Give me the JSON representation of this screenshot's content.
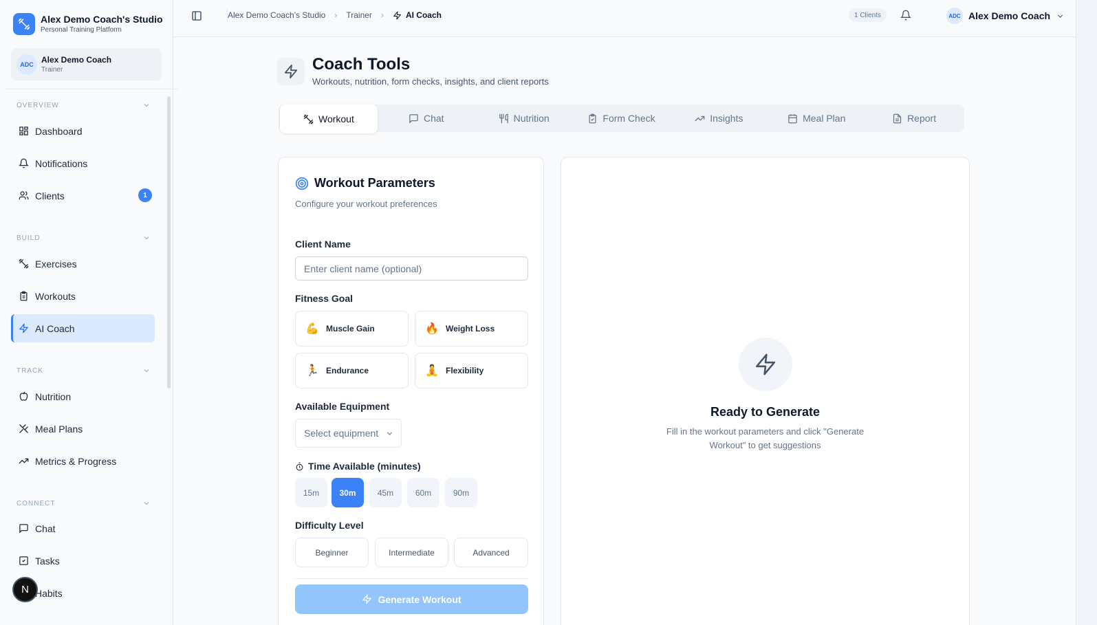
{
  "brand": {
    "name": "Alex Demo Coach's Studio",
    "subtitle": "Personal Training Platform"
  },
  "user": {
    "initials": "ADC",
    "name": "Alex Demo Coach",
    "role": "Trainer"
  },
  "sidebar": {
    "sections": {
      "overview": "OVERVIEW",
      "build": "BUILD",
      "track": "TRACK",
      "connect": "CONNECT"
    },
    "items": {
      "dashboard": "Dashboard",
      "notifications": "Notifications",
      "clients": "Clients",
      "clients_badge": "1",
      "exercises": "Exercises",
      "workouts": "Workouts",
      "ai_coach": "AI Coach",
      "nutrition": "Nutrition",
      "meal_plans": "Meal Plans",
      "metrics": "Metrics & Progress",
      "chat": "Chat",
      "tasks": "Tasks",
      "habits": "Habits"
    },
    "fab_letter": "N"
  },
  "topbar": {
    "breadcrumb": [
      "Alex Demo Coach's Studio",
      "Trainer",
      "AI Coach"
    ],
    "clients_count": "1 Clients",
    "user_initials": "ADC",
    "user_name": "Alex Demo Coach"
  },
  "page": {
    "title": "Coach Tools",
    "subtitle": "Workouts, nutrition, form checks, insights, and client reports",
    "tabs": [
      "Workout",
      "Chat",
      "Nutrition",
      "Form Check",
      "Insights",
      "Meal Plan",
      "Report"
    ],
    "active_tab": "Workout"
  },
  "form": {
    "title": "Workout Parameters",
    "subtitle": "Configure your workout preferences",
    "client_name_label": "Client Name",
    "client_name_placeholder": "Enter client name (optional)",
    "client_name_value": "",
    "fitness_goal_label": "Fitness Goal",
    "goals": [
      {
        "emoji": "💪",
        "label": "Muscle Gain"
      },
      {
        "emoji": "🔥",
        "label": "Weight Loss"
      },
      {
        "emoji": "🏃",
        "label": "Endurance"
      },
      {
        "emoji": "🧘",
        "label": "Flexibility"
      }
    ],
    "equipment_label": "Available Equipment",
    "equipment_placeholder": "Select equipment",
    "time_label": "Time Available (minutes)",
    "times": [
      "15m",
      "30m",
      "45m",
      "60m",
      "90m"
    ],
    "selected_time": "30m",
    "difficulty_label": "Difficulty Level",
    "difficulties": [
      "Beginner",
      "Intermediate",
      "Advanced"
    ],
    "generate_label": "Generate Workout"
  },
  "result": {
    "title": "Ready to Generate",
    "message": "Fill in the workout parameters and click \"Generate Workout\" to get suggestions"
  },
  "colors": {
    "accent": "#3b82f6",
    "accent_light": "#dbeafe",
    "disabled_button": "#93c5fd"
  }
}
